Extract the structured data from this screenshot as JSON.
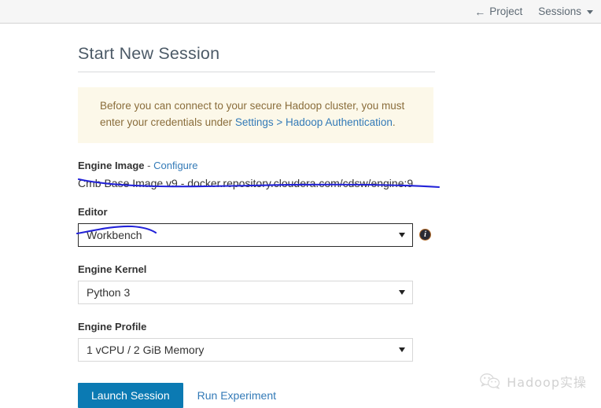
{
  "topbar": {
    "project_label": "Project",
    "back_arrow_icon": "arrow-left-icon",
    "sessions_label": "Sessions",
    "sessions_caret_icon": "caret-down-icon"
  },
  "page": {
    "title": "Start New Session"
  },
  "warning": {
    "text_before": "Before you can connect to your secure Hadoop cluster, you must enter your credentials under ",
    "link_text": "Settings > Hadoop Authentication",
    "text_after": ".",
    "background_color": "#fcf8e9",
    "text_color": "#8a6d3b",
    "link_color": "#337ab7"
  },
  "form": {
    "engine_image": {
      "label": "Engine Image",
      "separator": " - ",
      "configure_link": "Configure",
      "value": "Cmb Base Image v9 - docker.repository.cloudera.com/cdsw/engine:9"
    },
    "editor": {
      "label": "Editor",
      "value": "Workbench",
      "caret_icon": "caret-down-icon",
      "info_icon": "info-icon",
      "focused": true
    },
    "engine_kernel": {
      "label": "Engine Kernel",
      "value": "Python 3",
      "caret_icon": "caret-down-icon"
    },
    "engine_profile": {
      "label": "Engine Profile",
      "value": "1 vCPU / 2 GiB Memory",
      "caret_icon": "caret-down-icon"
    }
  },
  "actions": {
    "launch_label": "Launch Session",
    "launch_color": "#0b7ab3",
    "run_experiment_label": "Run Experiment",
    "run_experiment_color": "#337ab7"
  },
  "annotations": {
    "underline_color": "#2323d8",
    "engine_image_underline": "hand-drawn underline under engine image value",
    "editor_underline": "hand-drawn underline under Workbench"
  },
  "watermark": {
    "icon": "wechat-icon",
    "text": "Hadoop实操"
  }
}
